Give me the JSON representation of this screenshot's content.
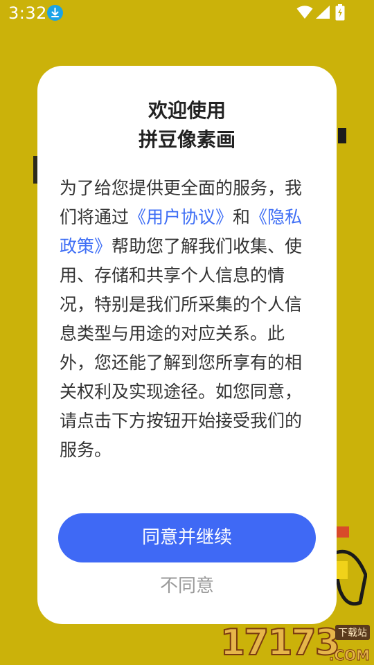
{
  "status_bar": {
    "time": "3:32",
    "icons": [
      "download-icon",
      "wifi-icon",
      "signal-icon",
      "battery-icon"
    ]
  },
  "dialog": {
    "title_line1": "欢迎使用",
    "title_line2": "拼豆像素画",
    "body": {
      "part1": "为了给您提供更全面的服务，我们将通过",
      "link_user_agreement": "《用户协议》",
      "part2": "和",
      "link_privacy_policy": "《隐私政策》",
      "part3": "帮助您了解我们收集、使用、存储和共享个人信息的情况，特别是我们所采集的个人信息类型与用途的对应关系。此外，您还能了解到您所享有的相关权利及实现途径。如您同意，请点击下方按钮开始接受我们的服务。"
    },
    "agree_label": "同意并继续",
    "disagree_label": "不同意"
  },
  "watermark": {
    "number": "17173",
    "tag": "下载站",
    "domain": ".COM"
  },
  "colors": {
    "background": "#cbb20a",
    "accent": "#3f69f5",
    "link": "#3e6ef5"
  }
}
